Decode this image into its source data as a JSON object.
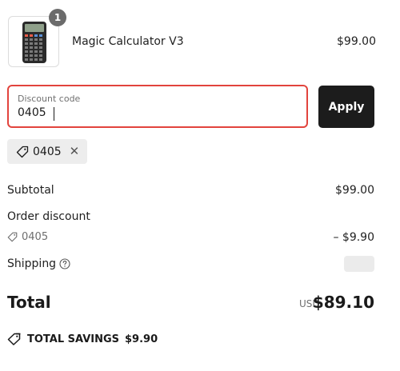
{
  "line_item": {
    "quantity": "1",
    "name": "Magic Calculator V3",
    "price": "$99.00"
  },
  "discount": {
    "label": "Discount code",
    "value": "0405",
    "apply_label": "Apply",
    "applied_code": "0405"
  },
  "summary": {
    "subtotal_label": "Subtotal",
    "subtotal_value": "$99.00",
    "order_discount_label": "Order discount",
    "order_discount_code": "0405",
    "order_discount_value": "– $9.90",
    "shipping_label": "Shipping",
    "total_label": "Total",
    "currency": "USD",
    "total_value": "$89.10"
  },
  "savings": {
    "label": "TOTAL SAVINGS",
    "amount": "$9.90"
  },
  "colors": {
    "error_border": "#e2443d",
    "apply_button": "#1c1c1c",
    "chip_background": "#ededed"
  },
  "icons": [
    "tag-icon",
    "close-icon",
    "question-icon",
    "savings-tag-icon"
  ]
}
